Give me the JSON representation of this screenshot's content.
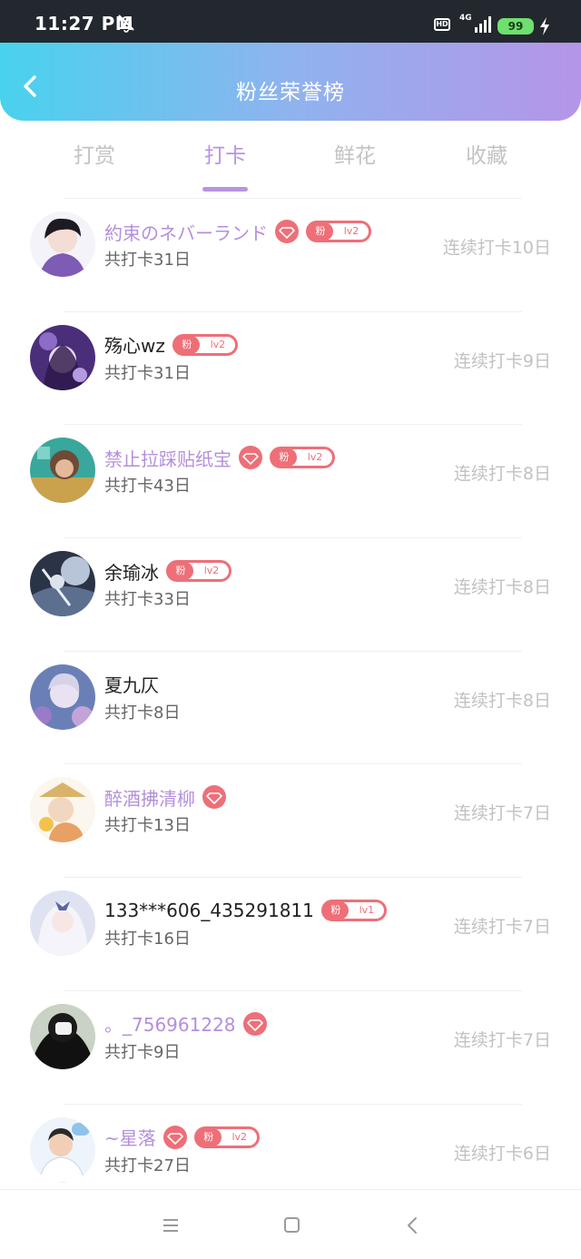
{
  "status_bar": {
    "time": "11:27 PM",
    "hd": "HD",
    "network": "4G",
    "battery": "99",
    "icons": [
      "mute-bell-icon",
      "signal-icon",
      "battery-icon",
      "charging-icon"
    ]
  },
  "header": {
    "title": "粉丝荣誉榜",
    "back_icon": "chevron-left-icon"
  },
  "tabs": [
    {
      "label": "打赏",
      "active": false
    },
    {
      "label": "打卡",
      "active": true
    },
    {
      "label": "鲜花",
      "active": false
    },
    {
      "label": "收藏",
      "active": false
    }
  ],
  "fans": [
    {
      "name": "約束のネバーランド",
      "vip": true,
      "gem": true,
      "fan_label": "粉",
      "level": "lv2",
      "total": "共打卡31日",
      "streak": "连续打卡10日"
    },
    {
      "name": "殇心wz",
      "vip": false,
      "gem": false,
      "fan_label": "粉",
      "level": "lv2",
      "total": "共打卡31日",
      "streak": "连续打卡9日"
    },
    {
      "name": "禁止拉踩贴纸宝",
      "vip": true,
      "gem": true,
      "fan_label": "粉",
      "level": "lv2",
      "total": "共打卡43日",
      "streak": "连续打卡8日"
    },
    {
      "name": "余瑜冰",
      "vip": false,
      "gem": false,
      "fan_label": "粉",
      "level": "lv2",
      "total": "共打卡33日",
      "streak": "连续打卡8日"
    },
    {
      "name": "夏九仄",
      "vip": false,
      "gem": false,
      "fan_label": null,
      "level": null,
      "total": "共打卡8日",
      "streak": "连续打卡8日"
    },
    {
      "name": "醉酒拂清柳",
      "vip": true,
      "gem": true,
      "fan_label": null,
      "level": null,
      "total": "共打卡13日",
      "streak": "连续打卡7日"
    },
    {
      "name": "133***606_435291811",
      "vip": false,
      "gem": false,
      "fan_label": "粉",
      "level": "lv1",
      "total": "共打卡16日",
      "streak": "连续打卡7日"
    },
    {
      "name": "。_756961228",
      "vip": true,
      "gem": true,
      "fan_label": null,
      "level": null,
      "total": "共打卡9日",
      "streak": "连续打卡7日"
    },
    {
      "name": "~星落",
      "vip": true,
      "gem": true,
      "fan_label": "粉",
      "level": "lv2",
      "total": "共打卡27日",
      "streak": "连续打卡6日"
    }
  ],
  "colors": {
    "accent": "#b894e2",
    "vip_name": "#b48fdc",
    "badge": "#ee6f78",
    "header_gradient_start": "#48d2ee",
    "header_gradient_end": "#b595e8"
  },
  "nav_bar": {
    "icons": [
      "menu-icon",
      "home-square-icon",
      "back-triangle-icon"
    ]
  }
}
